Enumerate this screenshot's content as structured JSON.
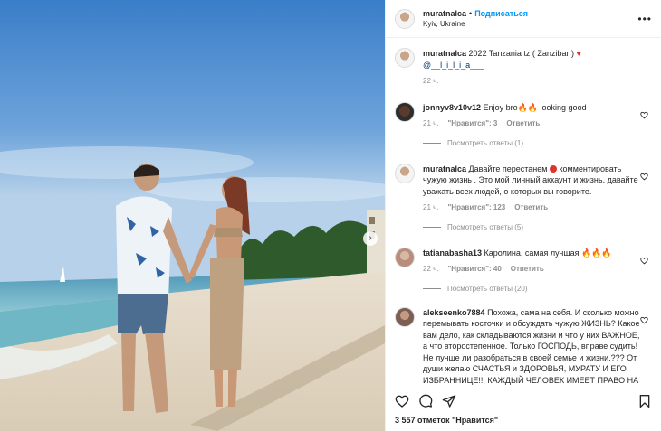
{
  "post": {
    "username": "muratnalca",
    "dot": "•",
    "follow_label": "Подписаться",
    "location": "Kyiv, Ukraine",
    "more_icon": "more-horizontal-icon"
  },
  "caption": {
    "username": "muratnalca",
    "text_before": "2022 Tanzania tz ( Zanzibar )",
    "text_after": "@__l_i_l_i_a___",
    "time": "22 ч."
  },
  "comments": [
    {
      "username": "jonnyv8v10v12",
      "text_before": "Enjoy bro",
      "fire": "🔥🔥",
      "text_after": "looking good",
      "time": "21 ч.",
      "likes": "\"Нравится\": 3",
      "reply": "Ответить",
      "view_replies": "Посмотреть ответы (1)"
    },
    {
      "username": "muratnalca",
      "text_before": "Давайте перестанем",
      "text_after": "комментировать чужую жизнь . Это мой личный аккаунт и жизнь. давайте уважать всех людей, о которых вы говорите.",
      "time": "21 ч.",
      "likes": "\"Нравится\": 123",
      "reply": "Ответить",
      "view_replies": "Посмотреть ответы (5)"
    },
    {
      "username": "tatianabasha13",
      "text_before": "Каролина, самая лучшая",
      "fire": "🔥🔥🔥",
      "time": "22 ч.",
      "likes": "\"Нравится\": 40",
      "reply": "Ответить",
      "view_replies": "Посмотреть ответы (20)"
    },
    {
      "username": "alekseenko7884",
      "text": "Похожа, сама на себя. И сколько можно перемывать косточки и обсуждать чужую ЖИЗНЬ? Какое вам дело, как складываются жизни и что у них ВАЖНОЕ, а что второстепенное. Только ГОСПОДЬ, вправе судить! Не лучше ли разобраться в своей семье и жизни.??? От души желаю СЧАСТЬЯ и ЗДОРОВЬЯ, МУРАТУ И ЕГО ИЗБРАННИЦЕ!!! КАЖДЫЙ ЧЕЛОВЕК ИМЕЕТ ПРАВО НА СЧАСТЬЕ!!! ХВАТИТ УЖЕ СРАВНИВАТЬ И СЛЕДИТЬ-КТО, КАК, С КЕМ И КОГДА! ЖИЗНЬ ПРОЖИТЬ НЕ ПОЛЕ ПЕРЕЙТИ!!!"
    }
  ],
  "footer": {
    "likes_count": "3 557 отметок \"Нравится\""
  },
  "icons": {
    "like": "heart-icon",
    "comment": "comment-icon",
    "share": "send-icon",
    "save": "bookmark-icon",
    "next": "chevron-right-icon"
  },
  "colors": {
    "accent": "#0095f6",
    "text": "#262626",
    "muted": "#8e8e8e"
  }
}
